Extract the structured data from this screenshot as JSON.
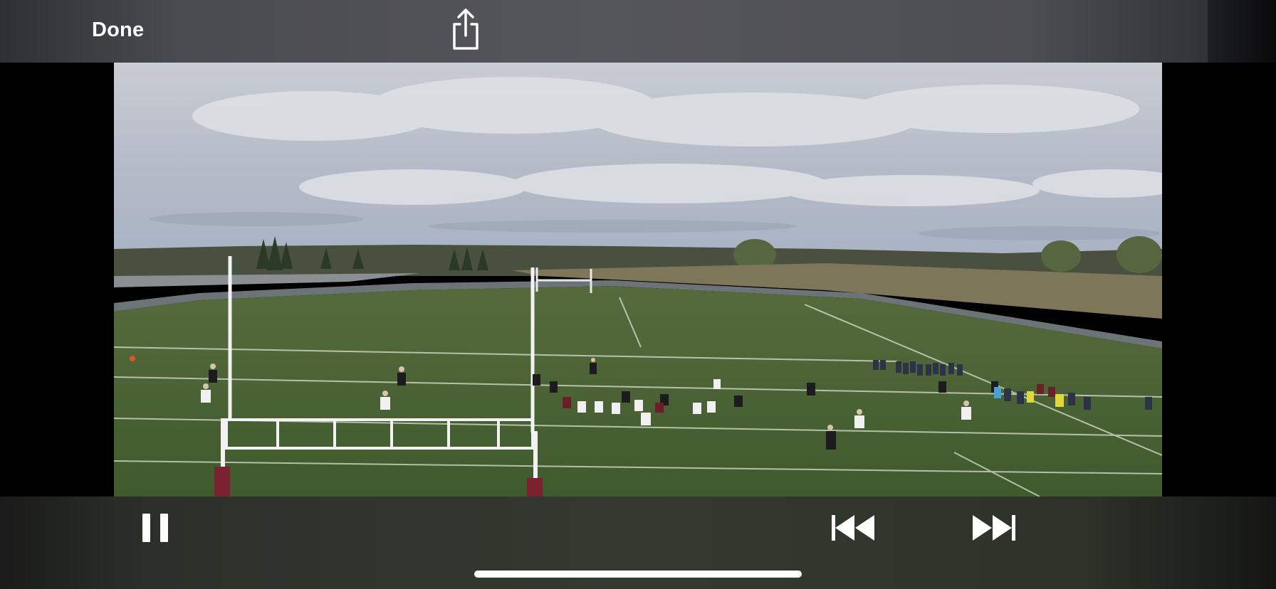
{
  "top_bar": {
    "done_label": "Done",
    "share_icon": "share-icon"
  },
  "video": {
    "description_icon": "video-frame-football-field"
  },
  "controls": {
    "pause_icon": "pause-icon",
    "previous_icon": "skip-back-icon",
    "next_icon": "skip-forward-icon"
  },
  "colors": {
    "bar_background": "#4f5055",
    "controls_background": "#343a30",
    "icon_color": "#ffffff"
  }
}
